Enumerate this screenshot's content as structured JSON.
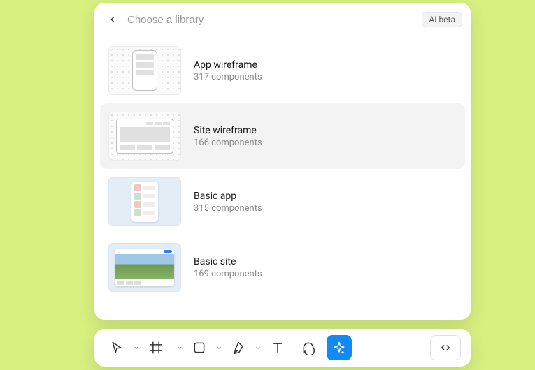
{
  "header": {
    "search_placeholder": "Choose a library",
    "ai_badge": "AI beta"
  },
  "libraries": [
    {
      "title": "App wireframe",
      "subtitle": "317 components"
    },
    {
      "title": "Site wireframe",
      "subtitle": "166 components"
    },
    {
      "title": "Basic app",
      "subtitle": "315 components"
    },
    {
      "title": "Basic site",
      "subtitle": "169 components"
    }
  ],
  "toolbar": {
    "tools": [
      "move",
      "frame",
      "rectangle",
      "pen",
      "text",
      "comment",
      "actions",
      "dev"
    ]
  }
}
